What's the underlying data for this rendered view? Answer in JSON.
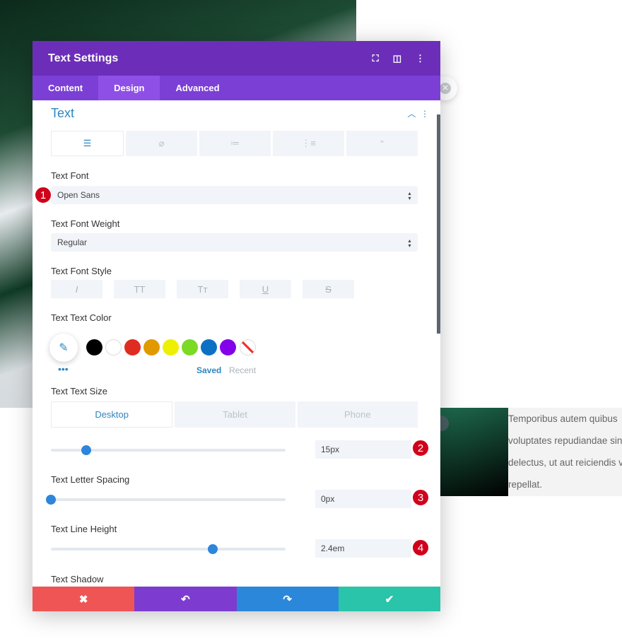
{
  "header": {
    "title": "Text Settings"
  },
  "tabs": [
    {
      "label": "Content"
    },
    {
      "label": "Design"
    },
    {
      "label": "Advanced"
    }
  ],
  "section": {
    "title": "Text"
  },
  "text_tabs": [
    "left-align-icon",
    "link-icon",
    "unordered-list-icon",
    "ordered-list-icon",
    "quote-icon"
  ],
  "fields": {
    "font_label": "Text Font",
    "font_value": "Open Sans",
    "weight_label": "Text Font Weight",
    "weight_value": "Regular",
    "style_label": "Text Font Style",
    "style_buttons": [
      "I",
      "TT",
      "Tт",
      "U",
      "S"
    ],
    "color_label": "Text Text Color",
    "swatches": [
      "#000000",
      "#ffffff",
      "#e02b20",
      "#e09900",
      "#edf000",
      "#7cda24",
      "#0c71c3",
      "#8300e9"
    ],
    "saved": "Saved",
    "recent": "Recent",
    "size_label": "Text Text Size",
    "devices": [
      "Desktop",
      "Tablet",
      "Phone"
    ],
    "size_value": "15px",
    "size_fraction": 0.15,
    "spacing_label": "Text Letter Spacing",
    "spacing_value": "0px",
    "spacing_fraction": 0.0,
    "line_label": "Text Line Height",
    "line_value": "2.4em",
    "line_fraction": 0.69,
    "shadow_label": "Text Shadow"
  },
  "badges": [
    "1",
    "2",
    "3",
    "4"
  ],
  "preview_text": [
    "Temporibus autem quibus",
    "voluptates repudiandae sin",
    "delectus, ut aut reiciendis v",
    "repellat."
  ],
  "footer_colors": {
    "cancel": "#ef5555",
    "undo": "#7e3bd0",
    "redo": "#2b87da",
    "save": "#29c4a9"
  },
  "accent": "#2e86c1"
}
